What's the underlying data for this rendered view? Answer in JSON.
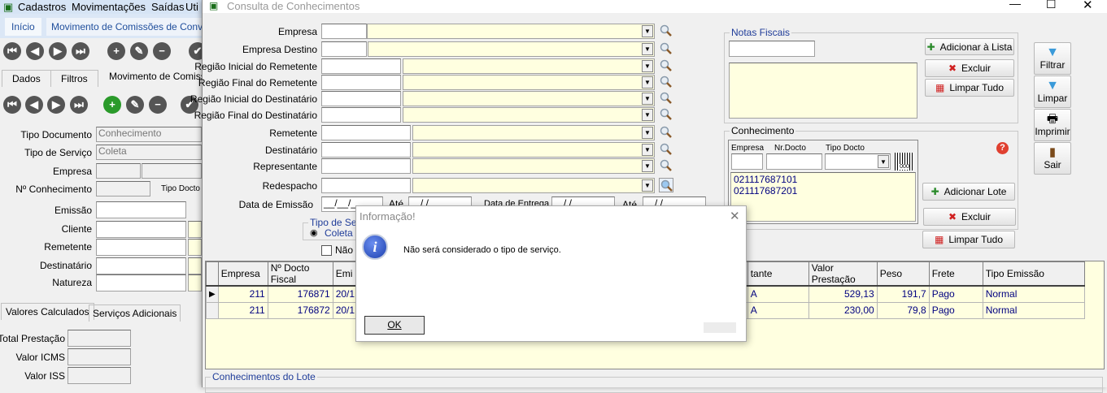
{
  "background_app": {
    "menu": [
      "Cadastros",
      "Movimentações",
      "Saídas",
      "Uti"
    ],
    "tabs": [
      "Início",
      "Movimento de Comissões de Convênio"
    ],
    "sub_tabs": [
      "Dados",
      "Filtros",
      "Movimento de Comissão"
    ],
    "fields": {
      "tipo_documento_label": "Tipo Documento",
      "tipo_documento_value": "Conhecimento",
      "tipo_servico_label": "Tipo de Serviço",
      "tipo_servico_value": "Coleta",
      "empresa_label": "Empresa",
      "conhecimento_label": "Nº Conhecimento",
      "tipo_docto_label": "Tipo Docto",
      "emissao_label": "Emissão",
      "cliente_label": "Cliente",
      "remetente_label": "Remetente",
      "destinatario_label": "Destinatário",
      "natureza_label": "Natureza"
    },
    "bottom_tabs": [
      "Valores Calculados",
      "Serviços Adicionais"
    ],
    "values": {
      "total_label": "Total Prestação",
      "icms_label": "Valor ICMS",
      "iss_label": "Valor ISS"
    }
  },
  "window": {
    "title": "Consulta de Conhecimentos",
    "filters": {
      "empresa": "Empresa",
      "empresa_destino": "Empresa Destino",
      "reg_ini_rem": "Região Inicial do Remetente",
      "reg_fin_rem": "Região Final do Remetente",
      "reg_ini_dest": "Região  Inicial do Destinatário",
      "reg_fin_dest": "Região Final do Destinatário",
      "remetente": "Remetente",
      "destinatario": "Destinatário",
      "representante": "Representante",
      "redespacho": "Redespacho",
      "data_emissao": "Data de Emissão",
      "data_emissao_value": "__/__/____",
      "ate": "Até",
      "ate_value": "/  /",
      "data_entrega": "Data de Entrega",
      "data_entrega_value": "/  /",
      "ate2": "Até",
      "ate2_value": "/  /"
    },
    "tipo_servico": {
      "title": "Tipo de Serv",
      "option": "Coleta"
    },
    "nao_checkbox": "Não I",
    "notas_fiscais": {
      "title": "Notas Fiscais",
      "add": "Adicionar à Lista",
      "excluir": "Excluir",
      "limpar": "Limpar Tudo"
    },
    "conhecimento": {
      "title": "Conhecimento",
      "empresa": "Empresa",
      "nr_docto": "Nr.Docto",
      "tipo_docto": "Tipo Docto",
      "barcode": "000",
      "items": [
        "021117687101",
        "021117687201"
      ],
      "add": "Adicionar Lote",
      "excluir": "Excluir",
      "limpar": "Limpar Tudo"
    },
    "side_buttons": [
      "Filtrar",
      "Limpar",
      "Imprimir",
      "Sair"
    ],
    "grid": {
      "headers": [
        "Empresa",
        "Nº Docto Fiscal",
        "Emi",
        "tante",
        "Valor Prestação",
        "Peso",
        "Frete",
        "Tipo Emissão"
      ],
      "rows": [
        [
          "211",
          "176871",
          "20/1",
          "A",
          "529,13",
          "191,7",
          "Pago",
          "Normal"
        ],
        [
          "211",
          "176872",
          "20/1",
          "A",
          "230,00",
          "79,8",
          "Pago",
          "Normal"
        ]
      ]
    },
    "lote_title": "Conhecimentos do Lote"
  },
  "dialog": {
    "title": "Informação!",
    "message": "Não será considerado o tipo de serviço.",
    "ok": "OK"
  }
}
